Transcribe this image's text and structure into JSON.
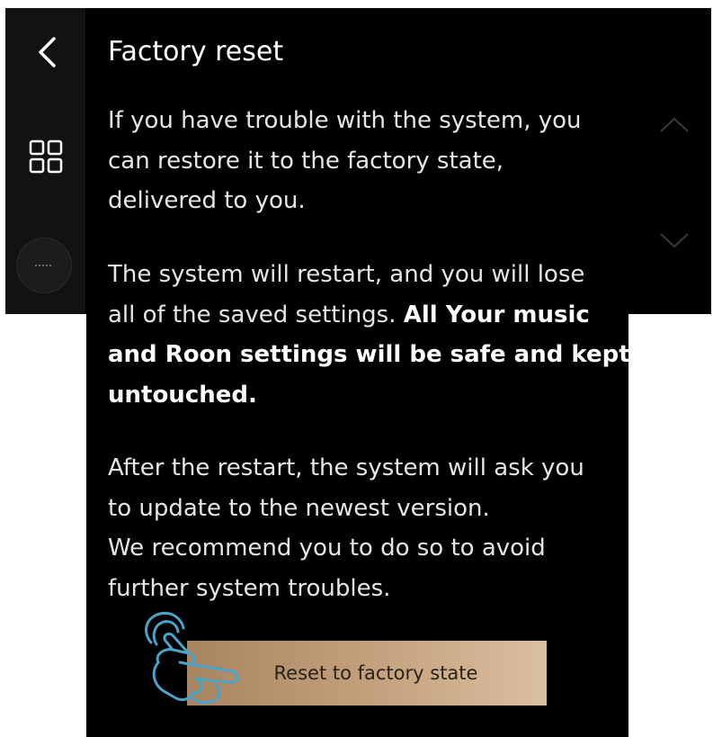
{
  "page": {
    "title": "Factory reset"
  },
  "sidebar": {
    "back_icon": "chevron-left-icon",
    "grid_icon": "grid-icon",
    "device_icon": "device-circle-icon"
  },
  "content": {
    "paragraph1": [
      "If you have trouble with the system, you",
      "can restore it to the factory state,",
      "delivered to you."
    ],
    "paragraph2_normal": [
      "The system will restart, and you will lose",
      "all of the saved settings. "
    ],
    "paragraph2_bold": [
      "All Your music",
      "and Roon settings will be safe and kept",
      "untouched."
    ],
    "paragraph3": [
      "After the restart, the system will ask you",
      "to update to the newest version.",
      "We recommend you to do so to avoid",
      "further system troubles."
    ]
  },
  "scroll": {
    "up_icon": "chevron-up-icon",
    "down_icon": "chevron-down-icon"
  },
  "action": {
    "reset_label": "Reset to factory state",
    "hint_icon": "tap-hand-icon"
  },
  "colors": {
    "background": "#000000",
    "sidebar": "#121212",
    "button_gradient_start": "#a98460",
    "button_gradient_end": "#d9bfa0",
    "hand_outline": "#4aa3c8"
  }
}
